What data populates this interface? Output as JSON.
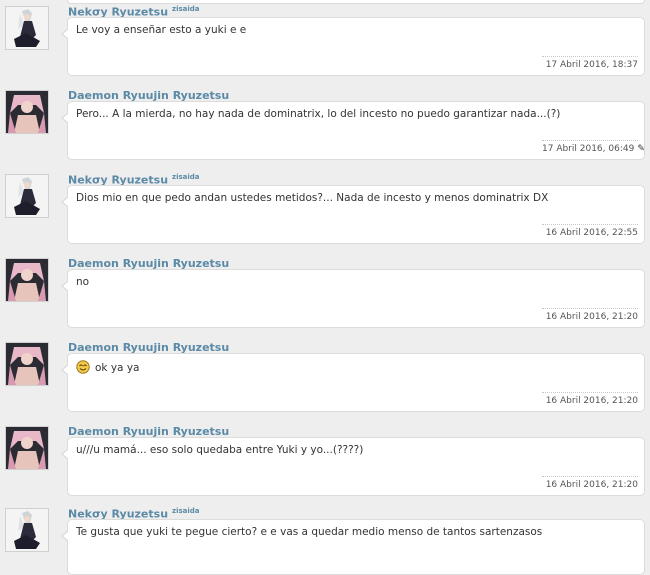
{
  "posts": [
    {
      "author": "Nekσy Ryuzetsu",
      "tag": "zisaida",
      "avatar": "anime-girl-avatar",
      "message": "Le voy a enseñar esto a yuki e e",
      "timestamp": "17 Abril 2016, 18:37"
    },
    {
      "author": "Daemon Ryuujin Ryuzetsu",
      "avatar": "anime-pink-hair-avatar",
      "message": "Pero... A la mierda, no hay nada de dominatrix, lo del incesto no puedo garantizar nada...(?)",
      "timestamp": "17 Abril 2016, 06:49",
      "edit_icon": "pencil-icon"
    },
    {
      "author": "Nekσy Ryuzetsu",
      "tag": "zisaida",
      "avatar": "anime-girl-avatar",
      "message": "Dios mio en que pedo andan ustedes metidos?... Nada de incesto y menos dominatrix DX",
      "timestamp": "16 Abril 2016, 22:55"
    },
    {
      "author": "Daemon Ryuujin Ryuzetsu",
      "avatar": "anime-pink-hair-avatar",
      "message": "no",
      "timestamp": "16 Abril 2016, 21:20"
    },
    {
      "author": "Daemon Ryuujin Ryuzetsu",
      "avatar": "anime-pink-hair-avatar",
      "emoji": "smiley-face-emoji",
      "message": "ok ya ya",
      "timestamp": "16 Abril 2016, 21:20"
    },
    {
      "author": "Daemon Ryuujin Ryuzetsu",
      "avatar": "anime-pink-hair-avatar",
      "message": "u///u mamá... eso solo quedaba entre Yuki y yo...(????)",
      "timestamp": "16 Abril 2016, 21:20"
    },
    {
      "author": "Nekσy Ryuzetsu",
      "tag": "zisaida",
      "avatar": "anime-girl-avatar",
      "message": "Te gusta que yuki te pegue cierto? e e vas a quedar medio menso de tantos sartenzasos",
      "timestamp": ""
    }
  ],
  "colors": {
    "background": "#eeeeee",
    "author": "#5b8aa6",
    "bubble": "#ffffff",
    "border": "#dcdcdc"
  }
}
